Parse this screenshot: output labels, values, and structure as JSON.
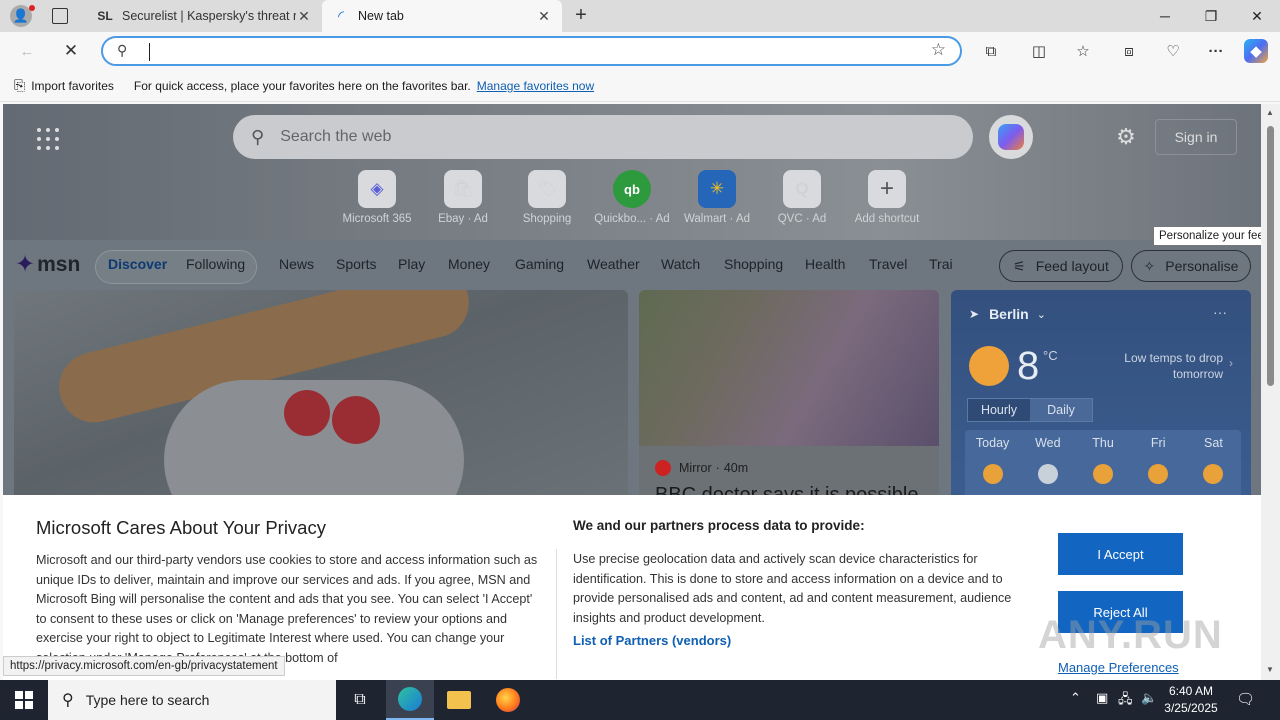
{
  "browser": {
    "tabs": [
      {
        "title": "Securelist | Kaspersky's threat res",
        "favicon": "SL"
      },
      {
        "title": "New tab"
      }
    ],
    "new_tab_symbol": "+",
    "address_value": "",
    "favorites_bar": {
      "import_label": "Import favorites",
      "hint": "For quick access, place your favorites here on the favorites bar.",
      "manage_link": "Manage favorites now"
    }
  },
  "msn": {
    "search_placeholder": "Search the web",
    "sign_in": "Sign in",
    "quick_links": [
      {
        "label": "Microsoft 365",
        "icon": "microsoft-365-icon",
        "glyph": "◈"
      },
      {
        "label": "Ebay · Ad",
        "icon": "ebay-icon",
        "glyph": "🛍"
      },
      {
        "label": "Shopping",
        "icon": "shopping-tag-icon",
        "glyph": "🏷"
      },
      {
        "label": "Quickbo... · Ad",
        "icon": "quickbooks-icon",
        "glyph": "qb"
      },
      {
        "label": "Walmart · Ad",
        "icon": "walmart-icon",
        "glyph": "✳"
      },
      {
        "label": "QVC · Ad",
        "icon": "qvc-icon",
        "glyph": "Q"
      },
      {
        "label": "Add shortcut",
        "icon": "plus-icon",
        "glyph": "+"
      }
    ],
    "logo": "msn",
    "nav": {
      "discover": "Discover",
      "following": "Following",
      "items": [
        "News",
        "Sports",
        "Play",
        "Money",
        "Gaming",
        "Weather",
        "Watch",
        "Shopping",
        "Health",
        "Travel",
        "Trai"
      ]
    },
    "feed_layout": "Feed layout",
    "personalise": "Personalise",
    "tooltip": "Personalize your feed",
    "news_card": {
      "source": "Mirror",
      "age": "40m",
      "headline": "BBC doctor says it is possible"
    },
    "weather": {
      "city": "Berlin",
      "temp": "8",
      "unit": "°C",
      "note": "Low temps to drop tomorrow",
      "tabs": [
        "Hourly",
        "Daily"
      ],
      "days": [
        "Today",
        "Wed",
        "Thu",
        "Fri",
        "Sat"
      ]
    }
  },
  "privacy": {
    "title": "Microsoft Cares About Your Privacy",
    "left_text": "Microsoft and our third-party vendors use cookies to store and access information such as unique IDs to deliver, maintain and improve our services and ads. If you agree, MSN and Microsoft Bing will personalise the content and ads that you see. You can select 'I Accept' to consent to these uses or click on 'Manage preferences' to review your options and exercise your right to object to Legitimate Interest where used. You can change your selection under 'Manage Preferences' at the bottom of",
    "right_title": "We and our partners process data to provide:",
    "right_text": "Use precise geolocation data and actively scan device characteristics for identification. This is done to store and access information on a device and to provide personalised ads and content, ad and content measurement, audience insights and product development.",
    "partners_link": "List of Partners (vendors)",
    "accept": "I Accept",
    "reject": "Reject All",
    "manage": "Manage Preferences"
  },
  "status_url": "https://privacy.microsoft.com/en-gb/privacystatement",
  "watermark": "ANY.RUN",
  "taskbar": {
    "search_placeholder": "Type here to search",
    "time": "6:40 AM",
    "date": "3/25/2025"
  },
  "colors": {
    "accent": "#1266c2",
    "link": "#0f5fb3",
    "omnibox_border": "#4a9ae6"
  }
}
